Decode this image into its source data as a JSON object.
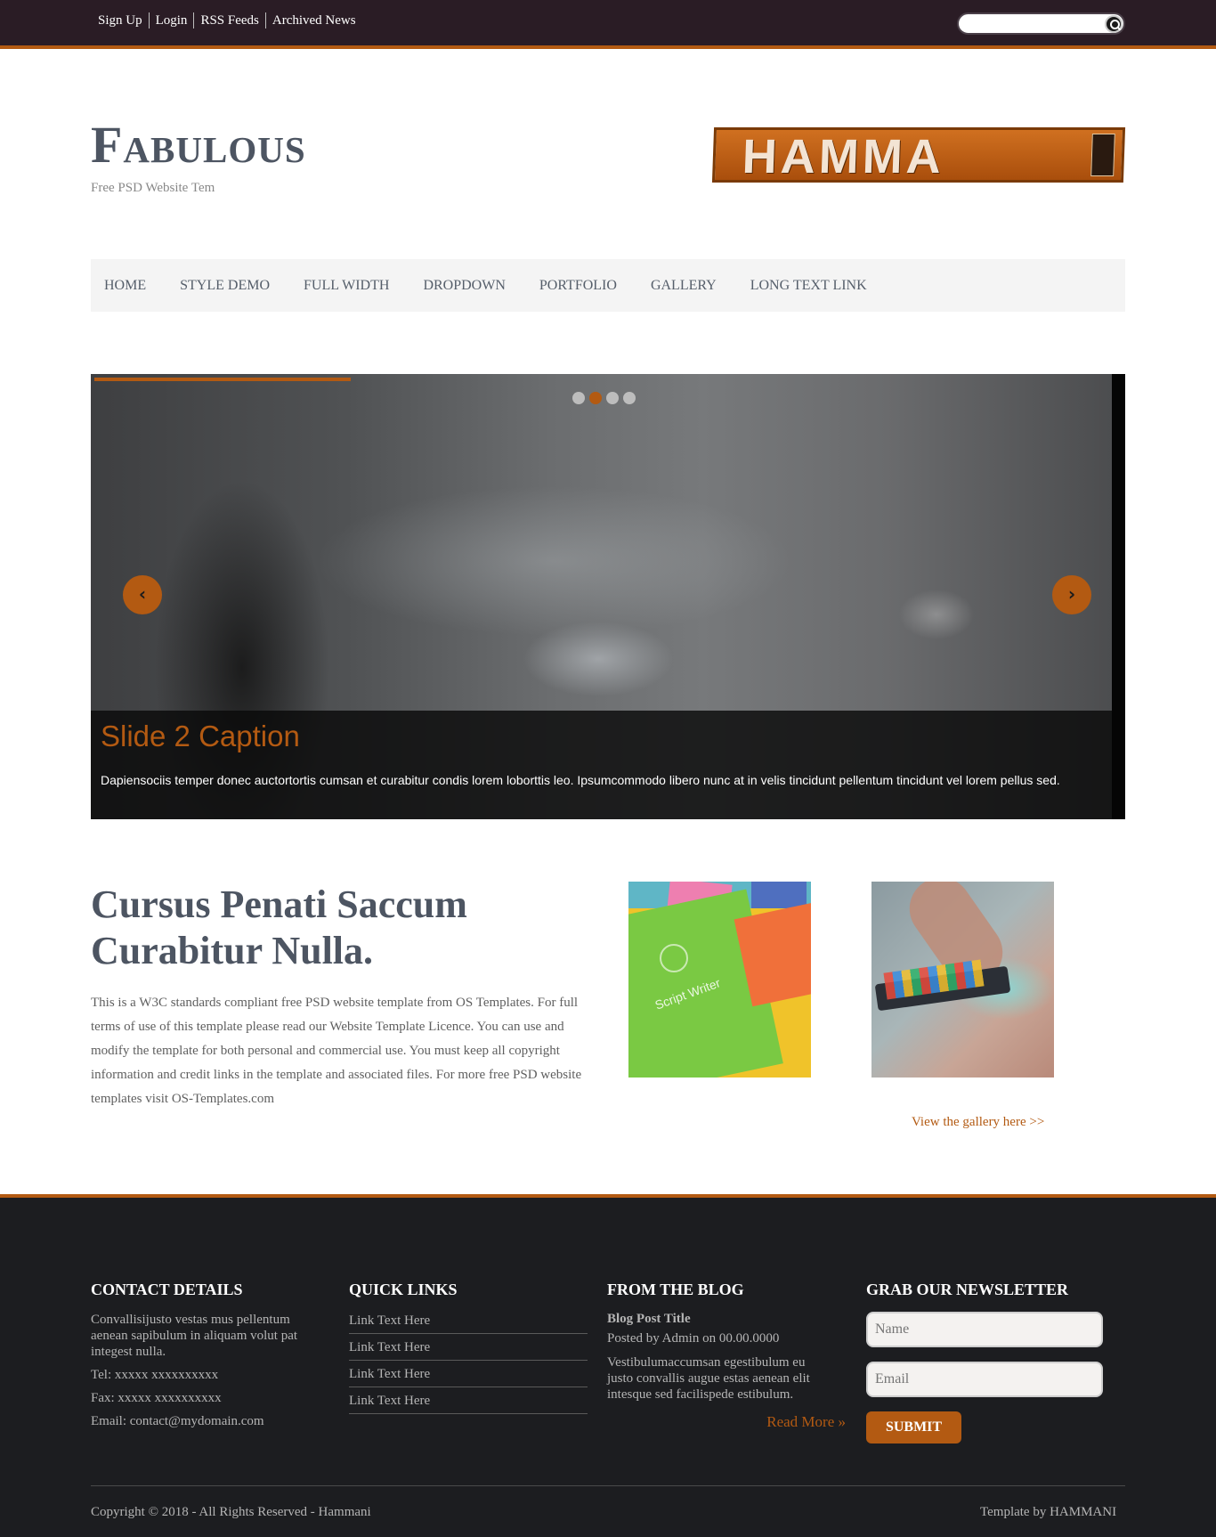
{
  "topbar": {
    "links": [
      "Sign Up",
      "Login",
      "RSS Feeds",
      "Archived News"
    ],
    "search_placeholder": ""
  },
  "header": {
    "title": "Fabulous",
    "subtitle": "Free PSD Website Tem",
    "banner_text": "HAMMA"
  },
  "nav": {
    "items": [
      "HOME",
      "STYLE DEMO",
      "FULL WIDTH",
      "DROPDOWN",
      "PORTFOLIO",
      "GALLERY",
      "LONG TEXT LINK"
    ]
  },
  "slider": {
    "caption_title": "Slide 2 Caption",
    "caption_text": "Dapiensociis temper donec auctortortis cumsan et curabitur condis lorem loborttis leo. Ipsumcommodo libero nunc at in velis tincidunt pellentum tincidunt vel lorem pellus sed.",
    "active_dot": 2,
    "dot_count": 4,
    "icons": {
      "prev": "chevron-left-icon",
      "next": "chevron-right-icon"
    }
  },
  "content": {
    "headline": "Cursus Penati Saccum Curabitur Nulla.",
    "intro": "This is a W3C standards compliant free PSD website template from OS Templates. For full terms of use of this template please read our Website Template Licence. You can use and modify the template for both personal and commercial use. You must keep all copyright information and credit links in the template and associated files. For more free PSD website templates visit OS-Templates.com",
    "thumb1_text": "Script Writer",
    "gallery_link": "View the gallery here >>"
  },
  "footer": {
    "contact": {
      "heading": "CONTACT DETAILS",
      "text": "Convallisijusto vestas mus pellentum aenean sapibulum in aliquam volut pat integest nulla.",
      "tel": "Tel: xxxxx xxxxxxxxxx",
      "fax": "Fax: xxxxx xxxxxxxxxx",
      "email": "Email: contact@mydomain.com"
    },
    "quick_links": {
      "heading": "QUICK LINKS",
      "items": [
        "Link Text Here",
        "Link Text Here",
        "Link Text Here",
        "Link Text Here"
      ]
    },
    "blog": {
      "heading": "FROM THE BLOG",
      "post_title": "Blog Post Title",
      "post_meta": "Posted by Admin on 00.00.0000",
      "post_body": "Vestibulumaccumsan egestibulum eu justo convallis augue estas aenean elit intesque sed facilispede estibulum.",
      "read_more": "Read More »"
    },
    "newsletter": {
      "heading": "GRAB OUR NEWSLETTER",
      "name_placeholder": "Name",
      "email_placeholder": "Email",
      "submit_label": "SUBMIT"
    },
    "copyright": "Copyright © 2018 - All Rights Reserved - Hammani",
    "credit": "Template by HAMMANI"
  },
  "colors": {
    "accent": "#b35a12",
    "topbar": "#2a1c25",
    "footer": "#1c1d20",
    "heading": "#4d5562"
  }
}
